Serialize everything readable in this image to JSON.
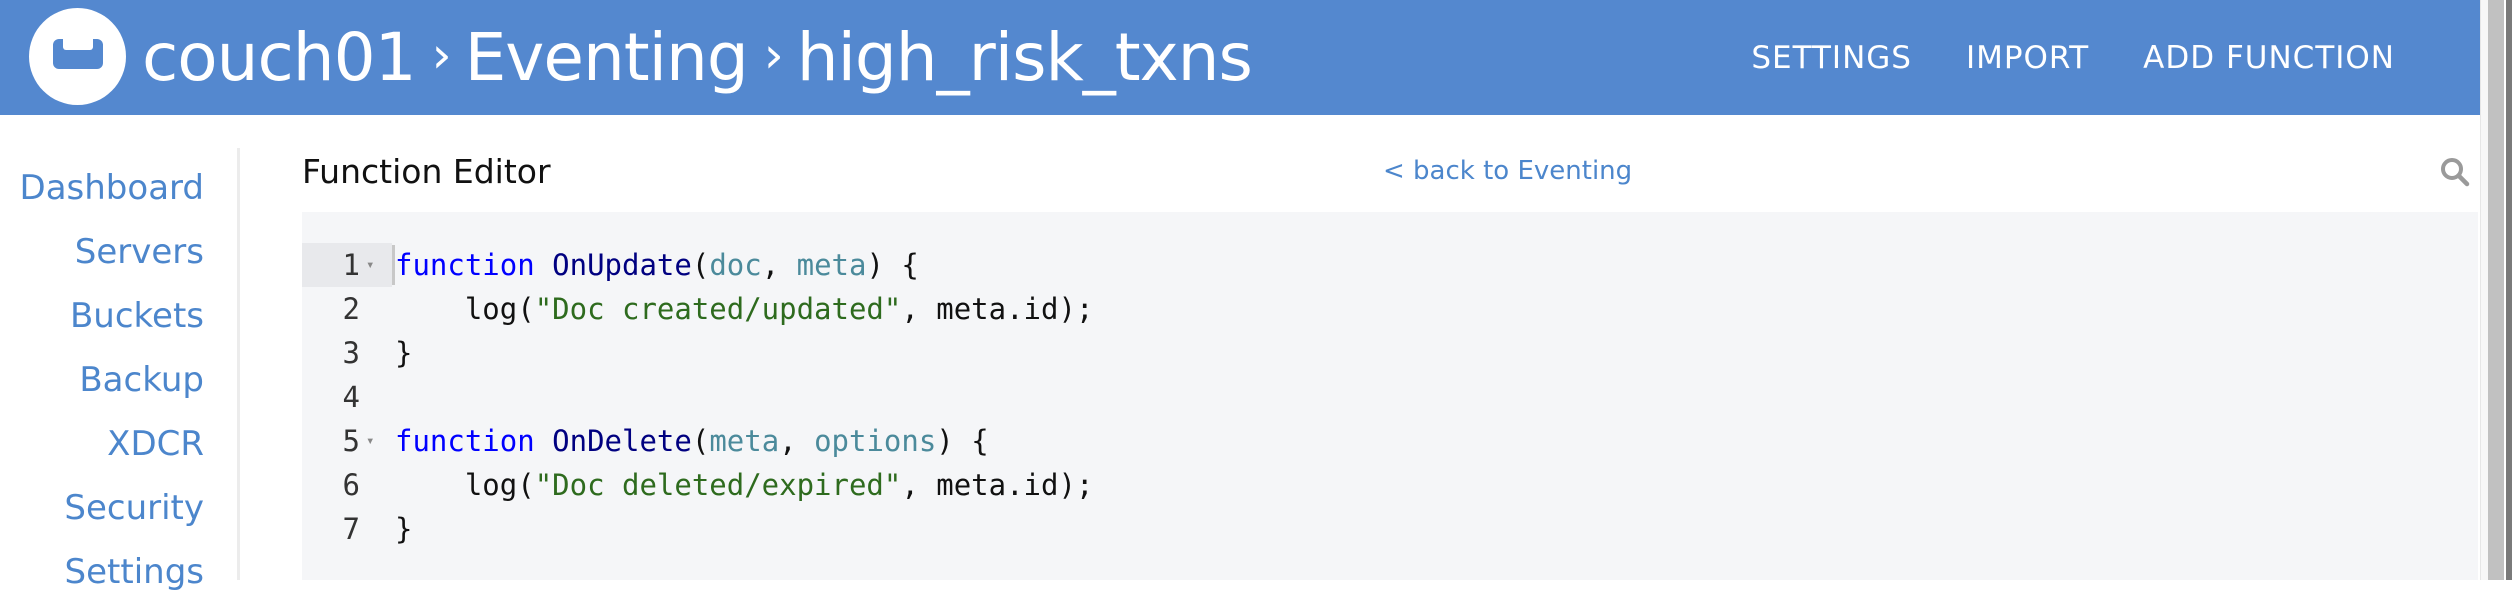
{
  "header": {
    "logo": "couchbase-logo",
    "breadcrumb": [
      "couch01",
      "Eventing",
      "high_risk_txns"
    ],
    "separator": "›",
    "actions": [
      "SETTINGS",
      "IMPORT",
      "ADD FUNCTION"
    ]
  },
  "sidebar": {
    "items": [
      "Dashboard",
      "Servers",
      "Buckets",
      "Backup",
      "XDCR",
      "Security",
      "Settings"
    ]
  },
  "main": {
    "title": "Function Editor",
    "back_link": "< back to Eventing",
    "search_icon": "search-icon"
  },
  "editor": {
    "active_line": 1,
    "lines": [
      {
        "n": "1",
        "fold": true,
        "tokens": [
          [
            "keyword",
            "function"
          ],
          [
            "plain",
            " "
          ],
          [
            "func",
            "OnUpdate"
          ],
          [
            "plain",
            "("
          ],
          [
            "param",
            "doc"
          ],
          [
            "plain",
            ", "
          ],
          [
            "param",
            "meta"
          ],
          [
            "plain",
            ") {"
          ]
        ]
      },
      {
        "n": "2",
        "fold": false,
        "tokens": [
          [
            "plain",
            "    log("
          ],
          [
            "string",
            "\"Doc created/updated\""
          ],
          [
            "plain",
            ", meta.id);"
          ]
        ]
      },
      {
        "n": "3",
        "fold": false,
        "tokens": [
          [
            "plain",
            "}"
          ]
        ]
      },
      {
        "n": "4",
        "fold": false,
        "tokens": []
      },
      {
        "n": "5",
        "fold": true,
        "tokens": [
          [
            "keyword",
            "function"
          ],
          [
            "plain",
            " "
          ],
          [
            "func",
            "OnDelete"
          ],
          [
            "plain",
            "("
          ],
          [
            "param",
            "meta"
          ],
          [
            "plain",
            ", "
          ],
          [
            "param",
            "options"
          ],
          [
            "plain",
            ") {"
          ]
        ]
      },
      {
        "n": "6",
        "fold": false,
        "tokens": [
          [
            "plain",
            "    log("
          ],
          [
            "string",
            "\"Doc deleted/expired\""
          ],
          [
            "plain",
            ", meta.id);"
          ]
        ]
      },
      {
        "n": "7",
        "fold": false,
        "tokens": [
          [
            "plain",
            "}"
          ]
        ]
      }
    ]
  },
  "colors": {
    "header_bg": "#5488cf",
    "link": "#4c86cc",
    "editor_bg": "#f5f6f8"
  }
}
